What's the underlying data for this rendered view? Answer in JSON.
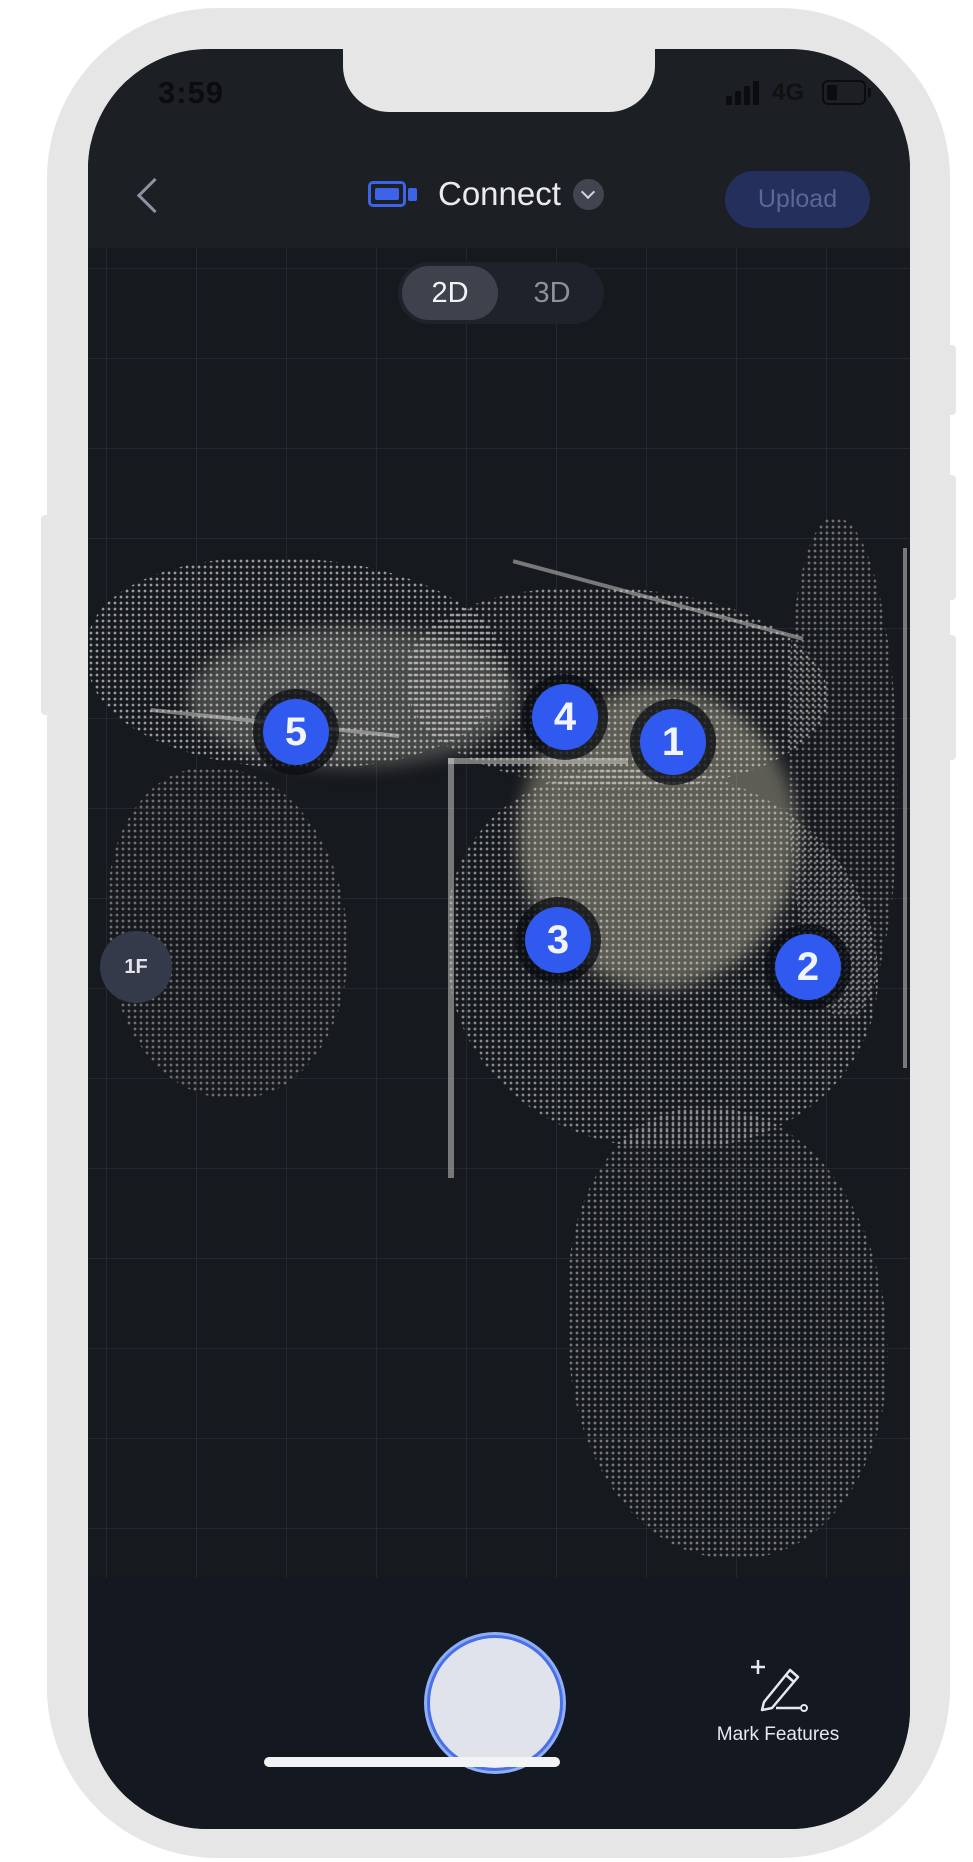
{
  "status": {
    "time": "3:59",
    "network": "4G"
  },
  "header": {
    "back_icon": "chevron-left-icon",
    "device_icon": "camera-icon",
    "title": "Connect",
    "dropdown_icon": "chevron-down-icon",
    "upload_label": "Upload"
  },
  "view_toggle": {
    "options": [
      "2D",
      "3D"
    ],
    "selected": "2D"
  },
  "map": {
    "floor_label": "1F",
    "markers": [
      "1",
      "2",
      "3",
      "4",
      "5"
    ]
  },
  "bottom": {
    "capture_icon": "shutter-button",
    "mark_icon": "pen-plus-icon",
    "mark_label": "Mark Features"
  },
  "colors": {
    "accent": "#3059f0",
    "background": "#1c1f23",
    "upload_bg": "#252f5c"
  }
}
